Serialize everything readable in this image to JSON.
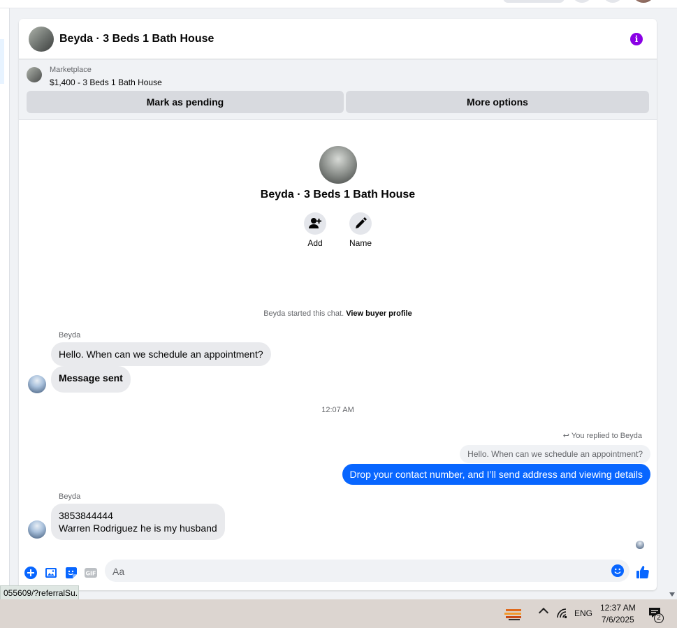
{
  "header": {
    "title": "Beyda · 3 Beds 1 Bath House"
  },
  "marketplace": {
    "label": "Marketplace",
    "listing": "$1,400 - 3 Beds 1 Bath House",
    "pending_button": "Mark as pending",
    "more_button": "More options"
  },
  "intro": {
    "title": "Beyda · 3 Beds 1 Bath House",
    "add_label": "Add",
    "name_label": "Name"
  },
  "chat_start": {
    "text": "Beyda started this chat.",
    "link": "View buyer profile"
  },
  "messages": {
    "sender1": "Beyda",
    "msg1": "Hello. When can we schedule an appointment?",
    "msg2": "Message sent",
    "timestamp": "12:07 AM",
    "reply_note": "You replied to Beyda",
    "reply_quote": "Hello. When can we schedule an appointment?",
    "outgoing": "Drop your contact number, and I’ll send address and viewing details",
    "sender2": "Beyda",
    "msg3_line1": "3853844444",
    "msg3_line2": "Warren Rodriguez he is my husband"
  },
  "composer": {
    "placeholder": "Aa"
  },
  "status_url": "055609/?referralSu...",
  "taskbar": {
    "language": "ENG",
    "time": "12:37 AM",
    "date": "7/6/2025",
    "notification_count": "2"
  },
  "colors": {
    "accent": "#0866ff",
    "info": "#8a00e5"
  }
}
